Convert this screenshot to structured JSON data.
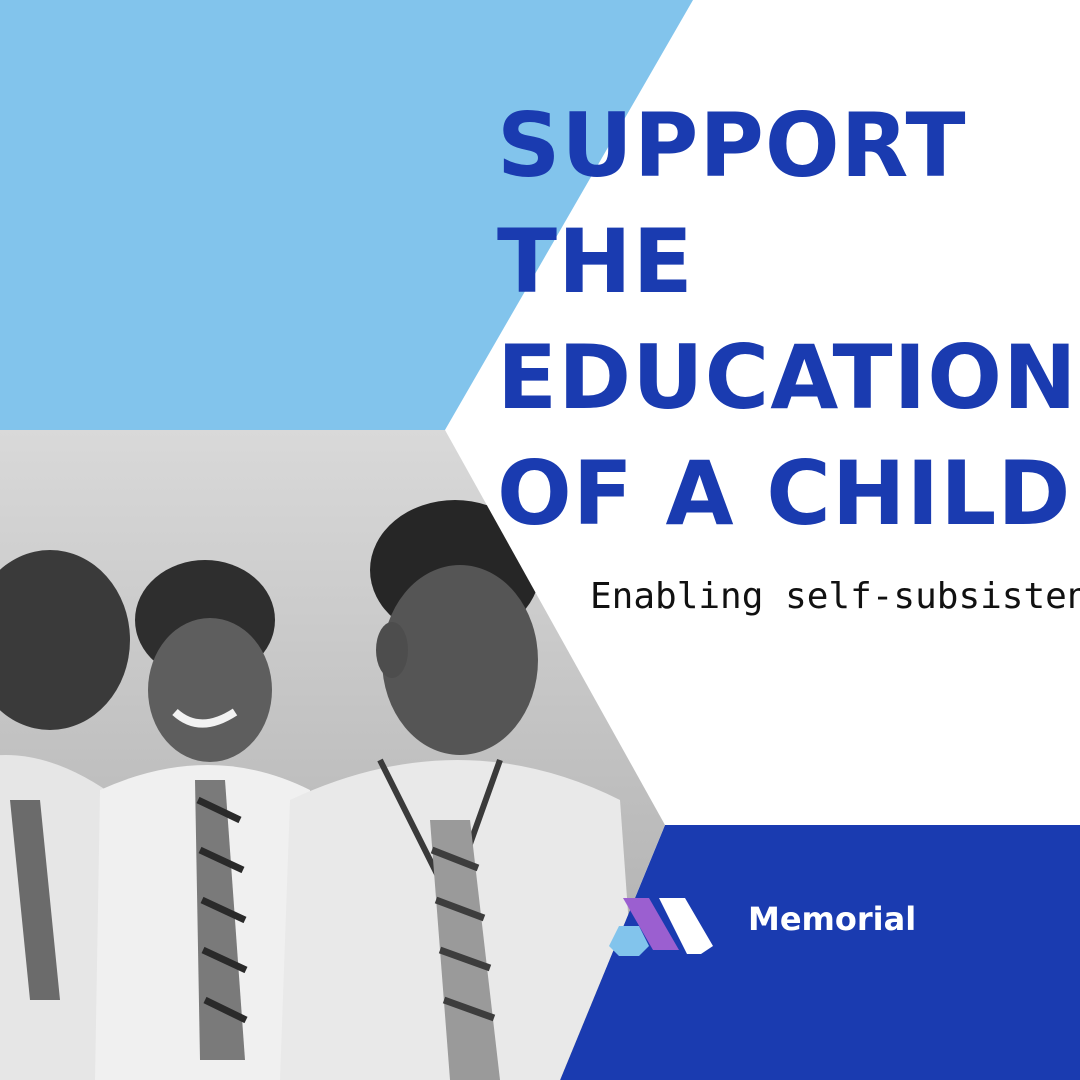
{
  "headline": {
    "line1": "SUPPORT",
    "line2": "THE",
    "line3": "EDUCATION",
    "line4": "OF A CHILD"
  },
  "tagline": "Enabling self-subsistence-",
  "brand": {
    "name": "Memorial",
    "logo_icon": "memorial-logo-icon"
  },
  "photo": {
    "subject": "schoolchildren-photo",
    "style": "black-and-white"
  },
  "colors": {
    "light_blue": "#82c4ec",
    "royal_blue": "#1a3bb0",
    "white": "#ffffff",
    "logo_purple": "#9b5fd0",
    "logo_light_blue": "#82c4ec"
  }
}
